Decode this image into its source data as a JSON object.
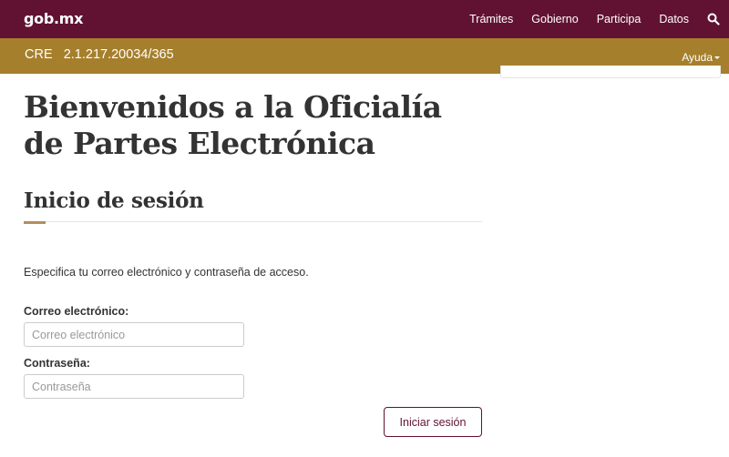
{
  "header": {
    "logo": "gob.mx",
    "nav": [
      "Trámites",
      "Gobierno",
      "Participa",
      "Datos"
    ],
    "search_icon": "search-icon"
  },
  "subheader": {
    "title": "CRE   2.1.217.20034/365",
    "help_label": "Ayuda"
  },
  "main": {
    "title": "Bienvenidos a la Oficialía de Partes Electrónica",
    "section_title": "Inicio de sesión",
    "instructions": "Especifica tu correo electrónico y contraseña de acceso.",
    "email": {
      "label": "Correo electrónico:",
      "placeholder": "Correo electrónico",
      "value": ""
    },
    "password": {
      "label": "Contraseña:",
      "placeholder": "Contraseña",
      "value": ""
    },
    "submit_label": "Iniciar sesión"
  },
  "colors": {
    "topbar": "#611232",
    "subbar": "#a57f2c",
    "accent": "#b38e5d"
  }
}
